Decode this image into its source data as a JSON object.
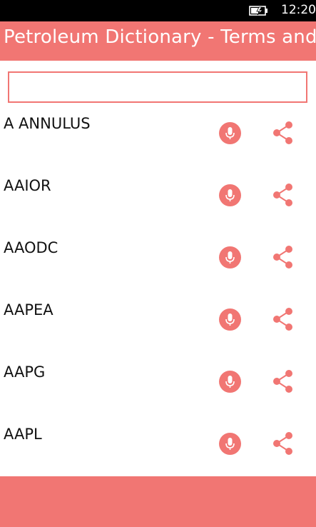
{
  "status": {
    "time": "12:20",
    "battery_icon": "battery-charging-icon"
  },
  "app": {
    "title": "Petroleum Dictionary - Terms and Definitions",
    "accent": "#f17673"
  },
  "search": {
    "value": "",
    "placeholder": ""
  },
  "terms": [
    {
      "label": "A ANNULUS"
    },
    {
      "label": "AAIOR"
    },
    {
      "label": "AAODC"
    },
    {
      "label": "AAPEA"
    },
    {
      "label": "AAPG"
    },
    {
      "label": "AAPL"
    }
  ],
  "icons": {
    "pronounce": "microphone-icon",
    "share": "share-icon"
  }
}
